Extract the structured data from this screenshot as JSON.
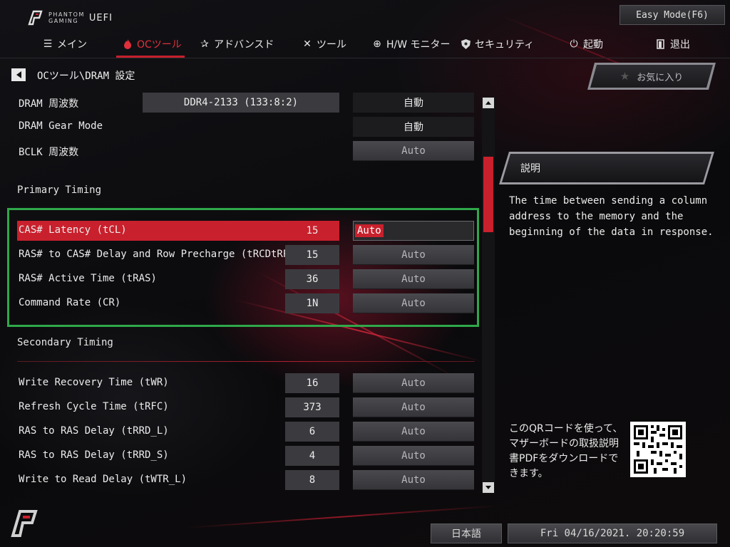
{
  "header": {
    "brand_line1": "PHANTOM",
    "brand_line2": "GAMING",
    "brand_uefi": "UEFI",
    "easy_mode_label": "Easy Mode(F6)"
  },
  "nav": {
    "active_index": 1,
    "tabs": [
      {
        "label": "メイン",
        "icon": "list-icon"
      },
      {
        "label": "OCツール",
        "icon": "flame-icon"
      },
      {
        "label": "アドバンスド",
        "icon": "star-icon"
      },
      {
        "label": "ツール",
        "icon": "tools-icon"
      },
      {
        "label": "H/W モニター",
        "icon": "crosshair-icon"
      },
      {
        "label": "セキュリティ",
        "icon": "shield-icon"
      },
      {
        "label": "起動",
        "icon": "power-icon"
      },
      {
        "label": "退出",
        "icon": "exit-icon"
      }
    ]
  },
  "breadcrumb": "OCツール\\DRAM 設定",
  "settings": {
    "dram_freq": {
      "label": "DRAM 周波数",
      "value": "DDR4-2133 (133:8:2)",
      "option": "自動"
    },
    "gear_mode": {
      "label": "DRAM Gear Mode",
      "option": "自動"
    },
    "bclk": {
      "label": "BCLK 周波数",
      "option": "Auto"
    },
    "primary_title": "Primary Timing",
    "primary": [
      {
        "label": "CAS# Latency (tCL)",
        "value": "15",
        "option": "Auto"
      },
      {
        "label": "RAS# to CAS# Delay and Row Precharge (tRCDtRP)",
        "value": "15",
        "option": "Auto"
      },
      {
        "label": "RAS# Active Time (tRAS)",
        "value": "36",
        "option": "Auto"
      },
      {
        "label": "Command Rate (CR)",
        "value": "1N",
        "option": "Auto"
      }
    ],
    "secondary_title": "Secondary Timing",
    "secondary": [
      {
        "label": "Write Recovery Time (tWR)",
        "value": "16",
        "option": "Auto"
      },
      {
        "label": "Refresh Cycle Time (tRFC)",
        "value": "373",
        "option": "Auto"
      },
      {
        "label": "RAS to RAS Delay (tRRD_L)",
        "value": "6",
        "option": "Auto"
      },
      {
        "label": "RAS to RAS Delay (tRRD_S)",
        "value": "4",
        "option": "Auto"
      },
      {
        "label": "Write to Read Delay (tWTR_L)",
        "value": "8",
        "option": "Auto"
      }
    ]
  },
  "right_panel": {
    "favorites_label": "お気に入り",
    "description_title": "説明",
    "description_text": "The time between sending a column address to the memory and the beginning of the data in response.",
    "qr_text": "このQRコードを使って、マザーボードの取扱説明書PDFをダウンロードできます。"
  },
  "footer": {
    "language": "日本語",
    "datetime": "Fri 04/16/2021. 20:20:59"
  },
  "colors": {
    "accent": "#c8202c",
    "highlight_box": "#2fa84a"
  }
}
